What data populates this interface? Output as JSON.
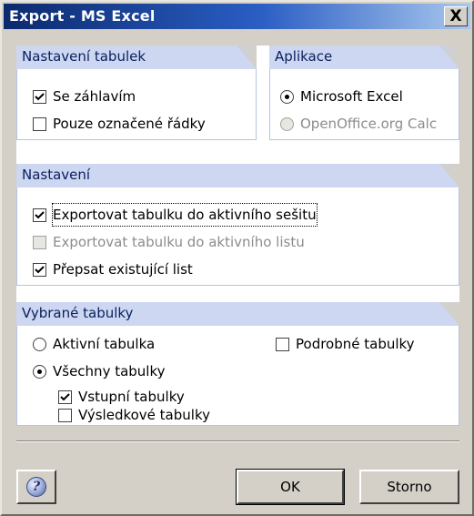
{
  "window": {
    "title": "Export - MS Excel",
    "close_label": "X"
  },
  "tables_settings": {
    "title": "Nastavení tabulek",
    "with_header": {
      "label": "Se záhlavím",
      "checked": true
    },
    "selected_rows_only": {
      "label": "Pouze označené řádky",
      "checked": false
    }
  },
  "application": {
    "title": "Aplikace",
    "ms_excel": {
      "label": "Microsoft Excel",
      "selected": true
    },
    "openoffice": {
      "label": "OpenOffice.org Calc",
      "selected": false,
      "disabled": true
    }
  },
  "settings": {
    "title": "Nastavení",
    "export_to_active_workbook": {
      "label": "Exportovat tabulku do aktivního sešitu",
      "checked": true
    },
    "export_to_active_sheet": {
      "label": "Exportovat tabulku do aktivního listu",
      "checked": false,
      "disabled": true
    },
    "overwrite_sheet": {
      "label": "Přepsat existující list",
      "checked": true
    }
  },
  "selected_tables": {
    "title": "Vybrané tabulky",
    "active_table": {
      "label": "Aktivní tabulka",
      "selected": false
    },
    "all_tables": {
      "label": "Všechny tabulky",
      "selected": true
    },
    "input_tables": {
      "label": "Vstupní tabulky",
      "checked": true
    },
    "result_tables": {
      "label": "Výsledkové tabulky",
      "checked": false
    },
    "detailed_tables": {
      "label": "Podrobné tabulky",
      "checked": false
    }
  },
  "buttons": {
    "help_icon": "help-icon",
    "help_glyph": "?",
    "ok": "OK",
    "cancel": "Storno"
  }
}
